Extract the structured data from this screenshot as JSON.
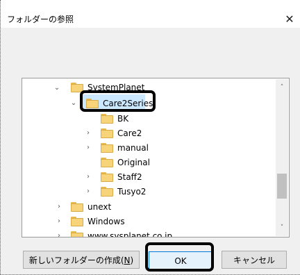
{
  "window": {
    "title": "フォルダーの参照",
    "close_glyph": "✕"
  },
  "tree": {
    "items": [
      {
        "label": "SystemPlanet",
        "expander": "⌄",
        "state": "expanded"
      },
      {
        "label": "Care2Series",
        "expander": "⌄",
        "state": "expanded-selected"
      },
      {
        "label": "BK",
        "expander": "",
        "state": "leaf"
      },
      {
        "label": "Care2",
        "expander": "›",
        "state": "collapsed"
      },
      {
        "label": "manual",
        "expander": "›",
        "state": "collapsed"
      },
      {
        "label": "Original",
        "expander": "",
        "state": "leaf"
      },
      {
        "label": "Staff2",
        "expander": "›",
        "state": "collapsed"
      },
      {
        "label": "Tusyo2",
        "expander": "›",
        "state": "collapsed"
      },
      {
        "label": "unext",
        "expander": "›",
        "state": "collapsed"
      },
      {
        "label": "Windows",
        "expander": "›",
        "state": "collapsed"
      },
      {
        "label": "www.sysplanet.co.jp",
        "expander": "›",
        "state": "collapsed"
      }
    ],
    "scroll": {
      "up_glyph": "˄",
      "down_glyph": "˅"
    }
  },
  "buttons": {
    "new_folder_prefix": "新しいフォルダーの作成(",
    "new_folder_key": "N",
    "new_folder_suffix": ")",
    "ok": "OK",
    "cancel": "キャンセル"
  },
  "colors": {
    "selection": "#cce8ff",
    "focus_border": "#0078d7",
    "folder": "#f7d47a"
  }
}
